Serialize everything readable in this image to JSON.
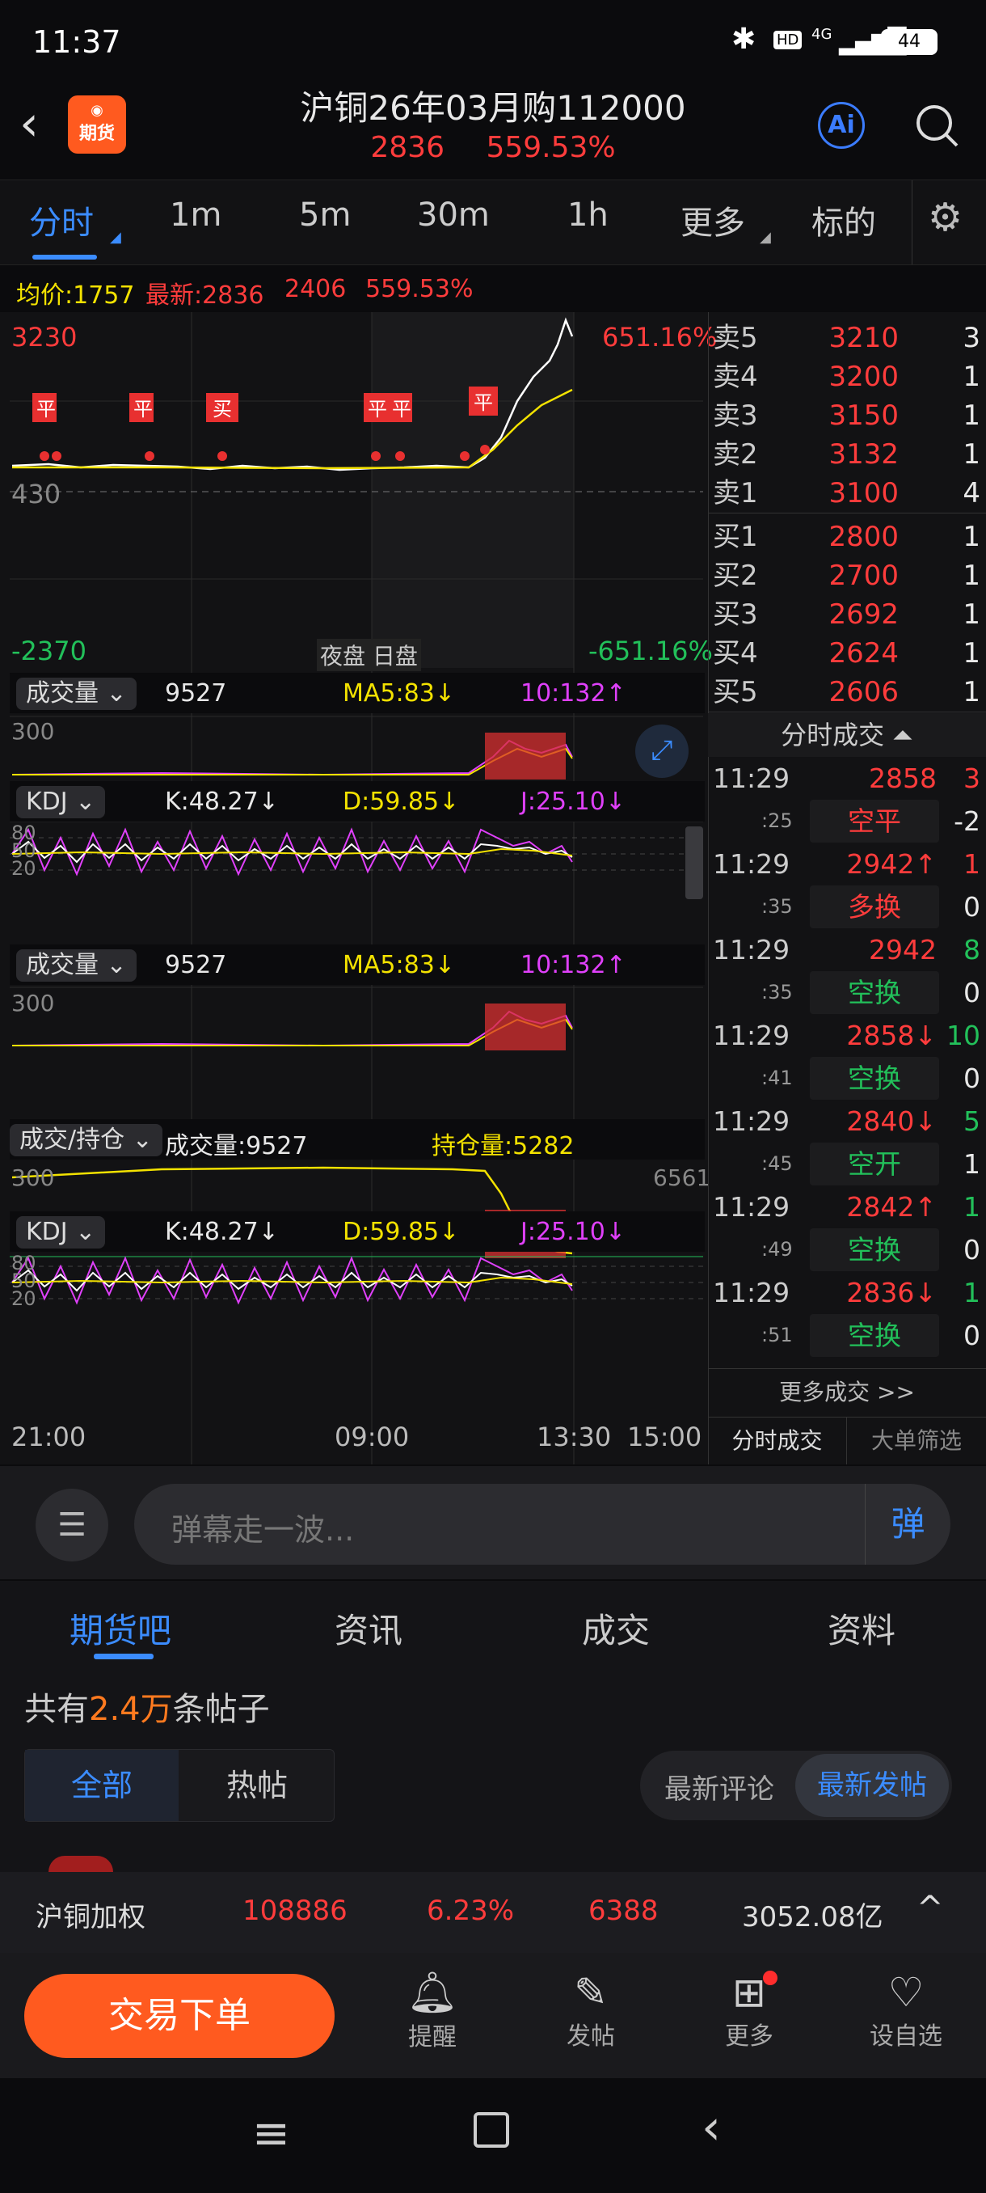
{
  "status": {
    "time": "11:37",
    "battery": "44",
    "net": "4G",
    "hd": "HD"
  },
  "header": {
    "title": "沪铜26年03月购112000",
    "price": "2836",
    "change_pct": "559.53%",
    "logo": "期货",
    "ai": "Ai"
  },
  "tabs": [
    "分时",
    "1m",
    "5m",
    "30m",
    "1h",
    "更多",
    "标的"
  ],
  "info": {
    "avg": "均价:1757",
    "latest": "最新:2836",
    "change": "2406",
    "pct": "559.53%"
  },
  "chart": {
    "top_price": "3230",
    "mid_price": "430",
    "bottom_price": "-2370",
    "top_pct": "651.16%",
    "bottom_pct": "-651.16%",
    "session_labels": "夜盘 日盘",
    "marker_buy": "买",
    "marker_close": "平"
  },
  "vol1": {
    "sel": "成交量",
    "val": "9527",
    "ma5": "MA5:83↓",
    "ma10": "10:132↑",
    "axis": "300"
  },
  "kdj1": {
    "sel": "KDJ",
    "k": "K:48.27↓",
    "d": "D:59.85↓",
    "j": "J:25.10↓",
    "a80": "80",
    "a50": "50",
    "a20": "20"
  },
  "vol2": {
    "sel": "成交量",
    "val": "9527",
    "ma5": "MA5:83↓",
    "ma10": "10:132↑",
    "axis": "300"
  },
  "oi": {
    "sel": "成交/持仓",
    "vol": "成交量:9527",
    "oi": "持仓量:5282",
    "axis": "300",
    "right": "6561"
  },
  "kdj2": {
    "sel": "KDJ",
    "k": "K:48.27↓",
    "d": "D:59.85↓",
    "j": "J:25.10↓",
    "a80": "80",
    "a50": "50",
    "a20": "20"
  },
  "times": [
    "21:00",
    "09:00",
    "13:30",
    "15:00"
  ],
  "orderbook": {
    "sells": [
      {
        "l": "卖5",
        "p": "3210",
        "q": "3"
      },
      {
        "l": "卖4",
        "p": "3200",
        "q": "1"
      },
      {
        "l": "卖3",
        "p": "3150",
        "q": "1"
      },
      {
        "l": "卖2",
        "p": "3132",
        "q": "1"
      },
      {
        "l": "卖1",
        "p": "3100",
        "q": "4"
      }
    ],
    "buys": [
      {
        "l": "买1",
        "p": "2800",
        "q": "1"
      },
      {
        "l": "买2",
        "p": "2700",
        "q": "1"
      },
      {
        "l": "买3",
        "p": "2692",
        "q": "1"
      },
      {
        "l": "买4",
        "p": "2624",
        "q": "1"
      },
      {
        "l": "买5",
        "p": "2606",
        "q": "1"
      }
    ]
  },
  "ticks_title": "分时成交",
  "ticks": [
    {
      "t": "11:29",
      "p": "2858",
      "pc": "red",
      "q": "3",
      "qc": "red",
      "s": ":25",
      "k": "空平",
      "kc": "red",
      "kq": "-2",
      "kqc": "white"
    },
    {
      "t": "11:29",
      "p": "2942↑",
      "pc": "red",
      "q": "1",
      "qc": "red",
      "s": ":35",
      "k": "多换",
      "kc": "red",
      "kq": "0",
      "kqc": "white"
    },
    {
      "t": "11:29",
      "p": "2942",
      "pc": "red",
      "q": "8",
      "qc": "green",
      "s": ":35",
      "k": "空换",
      "kc": "green",
      "kq": "0",
      "kqc": "white"
    },
    {
      "t": "11:29",
      "p": "2858↓",
      "pc": "red",
      "q": "10",
      "qc": "green",
      "s": ":41",
      "k": "空换",
      "kc": "green",
      "kq": "0",
      "kqc": "white"
    },
    {
      "t": "11:29",
      "p": "2840↓",
      "pc": "red",
      "q": "5",
      "qc": "green",
      "s": ":45",
      "k": "空开",
      "kc": "green",
      "kq": "1",
      "kqc": "white"
    },
    {
      "t": "11:29",
      "p": "2842↑",
      "pc": "red",
      "q": "1",
      "qc": "green",
      "s": ":49",
      "k": "空换",
      "kc": "green",
      "kq": "0",
      "kqc": "white"
    },
    {
      "t": "11:29",
      "p": "2836↓",
      "pc": "red",
      "q": "1",
      "qc": "green",
      "s": ":51",
      "k": "空换",
      "kc": "green",
      "kq": "0",
      "kqc": "white"
    }
  ],
  "more_ticks": "更多成交 >>",
  "tick_tabs": [
    "分时成交",
    "大单筛选"
  ],
  "danmu": {
    "placeholder": "弹幕走一波...",
    "btn": "弹"
  },
  "subtabs": [
    "期货吧",
    "资讯",
    "成交",
    "资料"
  ],
  "posts": {
    "prefix": "共有",
    "count": "2.4万",
    "suffix": "条帖子",
    "filter1": "全部",
    "filter2": "热帖",
    "sort1": "最新评论",
    "sort2": "最新发帖"
  },
  "ticker": {
    "name": "沪铜加权",
    "price": "108886",
    "pct": "6.23%",
    "chg": "6388",
    "amount": "3052.08亿"
  },
  "bottom": {
    "trade": "交易下单",
    "items": [
      "提醒",
      "发帖",
      "更多",
      "设自选"
    ]
  }
}
